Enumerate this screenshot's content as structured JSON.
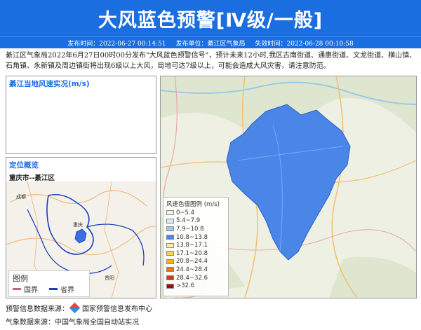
{
  "header": {
    "title": "大风蓝色预警[Ⅳ级/一般]"
  },
  "subbar": {
    "issue_time": "发布时间：2022-06-27 00:14:51",
    "issuer": "发布单位：綦江区气象局",
    "expire_time": "失效时间：2022-06-28 00:10:58"
  },
  "description": "綦江区气象局2022年6月27日00时00分发布\"大风蓝色预警信号\"，预计未来12小时,我区古南街道、通惠街道、文龙街道、横山镇、石角镇、永新镇及周边镇街将出现6级以上大风，局地可达7级以上，可能会造成大风灾害，请注意防范。",
  "wind_panel": {
    "title": "綦江当地风速实况(m/s)"
  },
  "location_panel": {
    "title": "定位概览",
    "subtitle": "重庆市--綦江区"
  },
  "mini_map": {
    "legend_title": "图例",
    "national_border": "国界",
    "provincial_border": "省界",
    "place_labels": [
      "成都",
      "重庆",
      "贵阳"
    ]
  },
  "wind_legend": {
    "title": "风速色值图例 (m/s)",
    "items": [
      {
        "label": "0~5.4",
        "color": "#f2f2f2"
      },
      {
        "label": "5.4~7.9",
        "color": "#d6eaf8"
      },
      {
        "label": "7.9~10.8",
        "color": "#9cc9f0"
      },
      {
        "label": "10.8~13.8",
        "color": "#4a86e8"
      },
      {
        "label": "13.8~17.1",
        "color": "#ffe8a0"
      },
      {
        "label": "17.1~20.8",
        "color": "#ffd24a"
      },
      {
        "label": "20.8~24.4",
        "color": "#ffb000"
      },
      {
        "label": "24.4~28.4",
        "color": "#f07020"
      },
      {
        "label": "28.4~32.6",
        "color": "#d03a1a"
      },
      {
        "label": ">32.6",
        "color": "#9a1010"
      }
    ]
  },
  "footer": {
    "source1_label": "预警信息数据来源：",
    "source1_value": "国家预警信息发布中心",
    "source2": "气象数据来源：中国气象局全国自动站实况"
  },
  "colors": {
    "header_blue": "#1a6ee0",
    "region_fill": "#4a86e8"
  }
}
